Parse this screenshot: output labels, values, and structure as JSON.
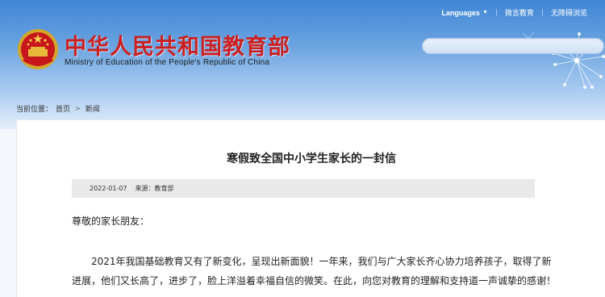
{
  "header": {
    "language_label": "Languages",
    "links": [
      "微言教育",
      "无障碍浏览"
    ],
    "title": "中华人民共和国教育部",
    "subtitle": "Ministry of Education of the People's Republic of China",
    "search_placeholder": ""
  },
  "breadcrumb": {
    "prefix": "当前位置：",
    "items": [
      "首页",
      "新闻"
    ]
  },
  "article": {
    "title": "寒假致全国中小学生家长的一封信",
    "date": "2022-01-07",
    "source": "来源：教育部",
    "greeting": "尊敬的家长朋友：",
    "body_lines": [
      "2021年我国基础教育又有了新变化，呈现出新面貌！一年来，我们与广大家长齐心协力培养孩子，取得了新",
      "进展，他们又长高了，进步了，脸上洋溢着幸福自信的微笑。在此，向您对教育的理解和支持道一声诚挚的感谢！"
    ]
  },
  "colors": {
    "title_red": "#cc1f1f",
    "header_blue": "#3f86d6",
    "meta_bar": "#e9e9e9"
  }
}
